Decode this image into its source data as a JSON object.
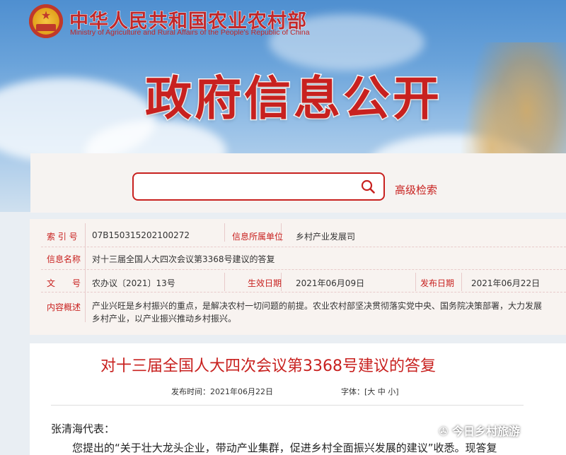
{
  "header": {
    "ministry_cn": "中华人民共和国农业农村部",
    "ministry_en": "Ministry of Agriculture and Rural Affairs of the People's Republic of China",
    "title": "政府信息公开"
  },
  "search": {
    "placeholder": "",
    "advanced_label": "高级检索"
  },
  "info": {
    "index_label": "索 引 号",
    "index_value": "07B150315202100272",
    "org_label": "信息所属单位",
    "org_value": "乡村产业发展司",
    "name_label": "信息名称",
    "name_value": "对十三届全国人大四次会议第3368号建议的答复",
    "doc_label": "文　　号",
    "doc_value": "农办议〔2021〕13号",
    "effective_label": "生效日期",
    "effective_value": "2021年06月09日",
    "publish_label": "发布日期",
    "publish_value": "2021年06月22日",
    "summary_label": "内容概述",
    "summary_value": "产业兴旺是乡村振兴的重点，是解决农村一切问题的前提。农业农村部坚决贯彻落实党中央、国务院决策部署，大力发展乡村产业，以产业振兴推动乡村振兴。"
  },
  "article": {
    "title": "对十三届全国人大四次会议第3368号建议的答复",
    "publish_time": "发布时间：2021年06月22日",
    "font_size": "字体：[大 中 小]",
    "salutation": "张清海代表：",
    "first_line": "您提出的“关于壮大龙头企业，带动产业集群，促进乡村全面振兴发展的建议”收悉。现答复"
  },
  "watermark": "今日乡村旅游",
  "colors": {
    "accent": "#c8211f",
    "panel": "#f8f3f0"
  }
}
